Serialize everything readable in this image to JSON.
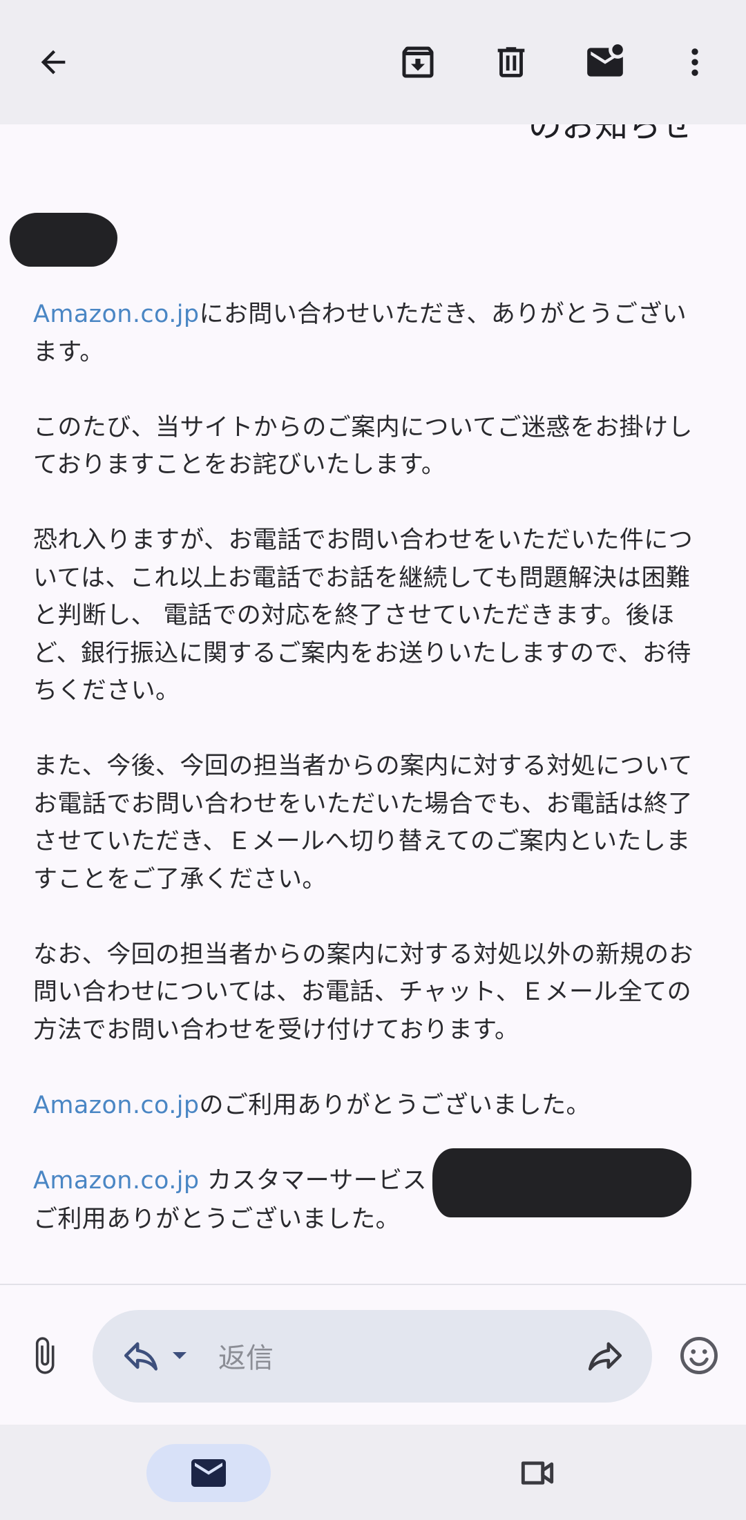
{
  "toolbar": {
    "icons": [
      "back-arrow-icon",
      "archive-icon",
      "delete-icon",
      "mark-unread-icon",
      "more-vert-icon"
    ]
  },
  "email": {
    "subject_fragment": "のお知らせ",
    "paragraphs": [
      {
        "link": "Amazon.co.jp",
        "text": "にお問い合わせいただき、ありがとうございます。"
      },
      {
        "text": "このたび、当サイトからのご案内についてご迷惑をお掛けしておりますことをお詫びいたします。"
      },
      {
        "text": "恐れ入りますが、お電話でお問い合わせをいただいた件については、これ以上お電話でお話を継続しても問題解決は困難と判断し、 電話での対応を終了させていただきます。後ほど、銀行振込に関するご案内をお送りいたしますので、お待ちください。"
      },
      {
        "text": "また、今後、今回の担当者からの案内に対する対処についてお電話でお問い合わせをいただいた場合でも、お電話は終了させていただき、Ｅメールへ切り替えてのご案内といたしますことをご了承ください。"
      },
      {
        "text": "なお、今回の担当者からの案内に対する対処以外の新規のお問い合わせについては、お電話、チャット、Ｅメール全ての方法でお問い合わせを受け付けております。"
      },
      {
        "link": "Amazon.co.jp",
        "text": "のご利用ありがとうございました。"
      }
    ],
    "signature": {
      "link": "Amazon.co.jp",
      "dept": " カスタマーサービス",
      "closing": "ご利用ありがとうございました。"
    }
  },
  "reply": {
    "placeholder": "返信",
    "icons": [
      "attach-icon",
      "reply-icon",
      "reply-options-chevron-icon",
      "forward-icon",
      "emoji-icon"
    ]
  },
  "nav": {
    "icons": [
      "mail-icon",
      "meet-video-icon"
    ],
    "active": "mail"
  },
  "colors": {
    "link": "#4a86c4",
    "toolbar_bg": "#eeedf2",
    "page_bg": "#fbf8fd",
    "reply_pill_bg": "#e3e6ef",
    "nav_active_bg": "#d8e1f8",
    "icon_dark": "#1f1f24",
    "icon_blue": "#3d4f7c"
  }
}
